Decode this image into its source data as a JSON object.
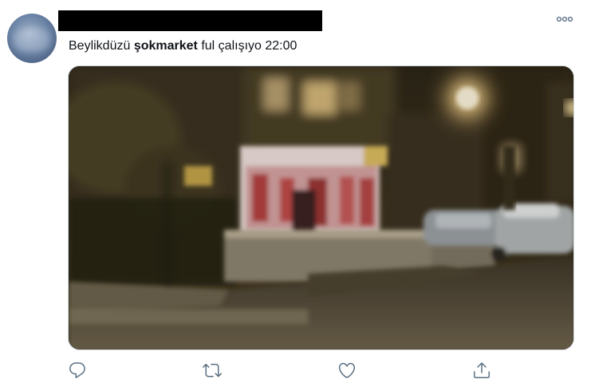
{
  "tweet": {
    "author_redacted": true,
    "text_before": "Beylikdüzü ",
    "text_bold": "şokmarket",
    "text_after": " ful çalışıyo 22:00",
    "media_alt": "Blurry night photo of a lit storefront on a street corner with parked cars and a street lamp"
  },
  "icons": {
    "more": "more-horizontal-icon",
    "reply": "reply-icon",
    "retweet": "retweet-icon",
    "like": "like-icon",
    "share": "share-icon"
  },
  "colors": {
    "text": "#0f1419",
    "secondary": "#5b7083",
    "border": "#cfd9de"
  }
}
